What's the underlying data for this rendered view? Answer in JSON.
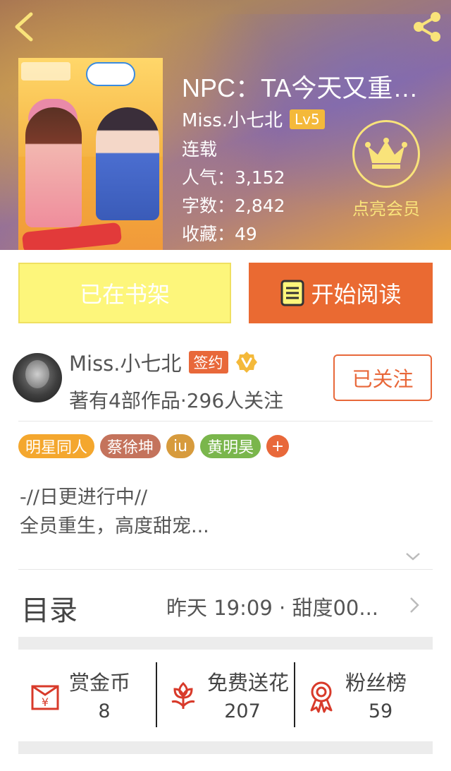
{
  "book": {
    "title": "NPC：TA今天又重…",
    "author": "Miss.小七北",
    "level": "Lv5",
    "status": "连载",
    "popularity": "人气：3,152",
    "word_count": "字数：2,842",
    "favorites": "收藏：49"
  },
  "vip": {
    "label": "点亮会员"
  },
  "actions": {
    "shelf_label": "已在书架",
    "read_label": "开始阅读"
  },
  "author_info": {
    "name": "Miss.小七北",
    "sign_badge": "签约",
    "stats": "著有4部作品·296人关注",
    "follow_label": "已关注"
  },
  "tags": [
    {
      "label": "明星同人",
      "color": "#f4a72e"
    },
    {
      "label": "蔡徐坤",
      "color": "#c4735c"
    },
    {
      "label": "iu",
      "color": "#d79b3d"
    },
    {
      "label": "黄明昊",
      "color": "#7ab64c"
    },
    {
      "label": "+",
      "color": "#e8683a"
    }
  ],
  "description": {
    "line1": "-//日更进行中//",
    "line2": "全员重生，高度甜宠..."
  },
  "toc": {
    "label": "目录",
    "latest": "昨天 19:09 · 甜度00..."
  },
  "stats": [
    {
      "label": "赏金币",
      "value": "8",
      "icon": "red-envelope-icon"
    },
    {
      "label": "免费送花",
      "value": "207",
      "icon": "flower-icon"
    },
    {
      "label": "粉丝榜",
      "value": "59",
      "icon": "medal-icon"
    }
  ],
  "colors": {
    "accent": "#ea6a32",
    "shelf": "#fdf67b",
    "vip_gold": "#f9e37a"
  }
}
